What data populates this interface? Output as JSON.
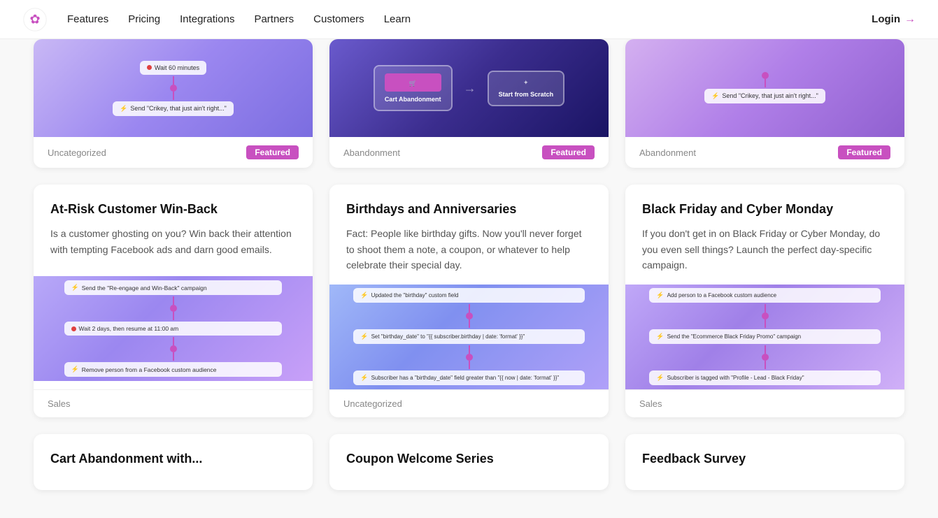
{
  "nav": {
    "features_label": "Features",
    "pricing_label": "Pricing",
    "integrations_label": "Integrations",
    "partners_label": "Partners",
    "customers_label": "Customers",
    "learn_label": "Learn",
    "login_label": "Login"
  },
  "top_row": [
    {
      "category": "Uncategorized",
      "badge": "Featured"
    },
    {
      "category": "Abandonment",
      "badge": "Featured"
    },
    {
      "category": "Abandonment",
      "badge": "Featured"
    }
  ],
  "cards": [
    {
      "title": "At-Risk Customer Win-Back",
      "desc": "Is a customer ghosting on you? Win back their attention with tempting Facebook ads and darn good emails.",
      "category": "Sales",
      "badge": null,
      "workflow_type": "win-back"
    },
    {
      "title": "Birthdays and Anniversaries",
      "desc": "Fact: People like birthday gifts. Now you'll never forget to shoot them a note, a coupon, or whatever to help celebrate their special day.",
      "category": "Uncategorized",
      "badge": null,
      "workflow_type": "birthday"
    },
    {
      "title": "Black Friday and Cyber Monday",
      "desc": "If you don't get in on Black Friday or Cyber Monday, do you even sell things? Launch the perfect day-specific campaign.",
      "category": "Sales",
      "badge": null,
      "workflow_type": "blackfriday"
    }
  ],
  "bottom_cards": [
    {
      "title": "Cart Abandonment with..."
    },
    {
      "title": "Coupon Welcome Series"
    },
    {
      "title": "Feedback Survey"
    }
  ],
  "workflows": {
    "top1": {
      "line1": "Wait 60 minutes",
      "line2": "Send \"Crikey, that just ain't right...\"",
      "type": "purple"
    },
    "top2": {
      "box1": "Cart Abandonment",
      "box2": "Start from Scratch",
      "type": "dark"
    },
    "top3": {
      "line1": "Send \"Crikey, that just ain't right...\"",
      "type": "pink"
    },
    "winback": {
      "line1": "Send the \"Re-engage and Win-Back\" campaign",
      "line2": "Wait 2 days, then resume at 11:00 am",
      "line3": "Remove person from a Facebook custom audience",
      "type": "purple"
    },
    "birthday": {
      "line1": "Updated the \"birthday\" custom field",
      "line2": "Set \"birthday_date\" to \"{{ subscriber.birthday | date: 'format' }}\"",
      "line3": "Subscriber has a \"birthday_date\" field greater than \"{{ now | date: 'format' }}\"",
      "type": "purple"
    },
    "blackfriday": {
      "line1": "Add person to a Facebook custom audience",
      "line2": "Send the \"Ecommerce Black Friday Promo\" campaign",
      "line3": "Subscriber is tagged with \"Profile - Lead - Black Friday\"",
      "type": "purple"
    }
  }
}
